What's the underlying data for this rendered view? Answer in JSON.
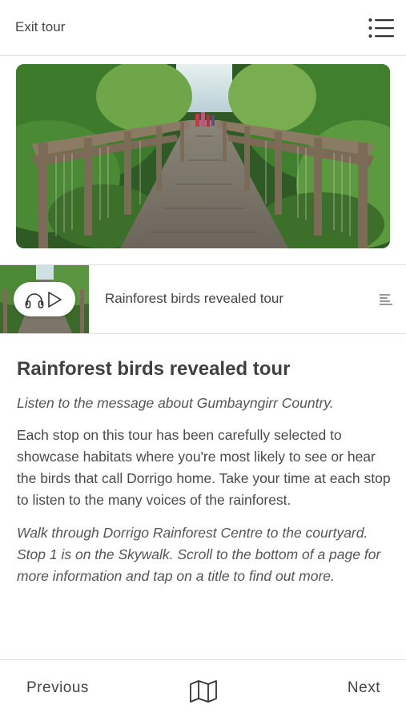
{
  "header": {
    "exit_label": "Exit tour",
    "menu_icon": "hamburger-menu-icon"
  },
  "hero_image": {
    "subject": "wooden boardwalk through rainforest canopy"
  },
  "audio_player": {
    "controls_icons": [
      "headphones-icon",
      "play-icon"
    ],
    "track_title": "Rainforest birds revealed tour",
    "list_icon": "text-list-icon"
  },
  "content": {
    "title": "Rainforest birds revealed tour",
    "intro": "Listen to the message about Gumbayngirr Country.",
    "body": "Each stop on this tour has been carefully selected to showcase habitats where you're most likely to see or hear the birds that call Dorrigo home. Take your time at each stop to listen to the many voices of the rainforest.",
    "directions": "Walk through Dorrigo Rainforest Centre to the courtyard. Stop 1 is on the Skywalk. Scroll to the bottom of a page for more information and tap on a title to find out more."
  },
  "footer": {
    "previous_label": "Previous",
    "next_label": "Next",
    "map_icon": "map-icon"
  }
}
